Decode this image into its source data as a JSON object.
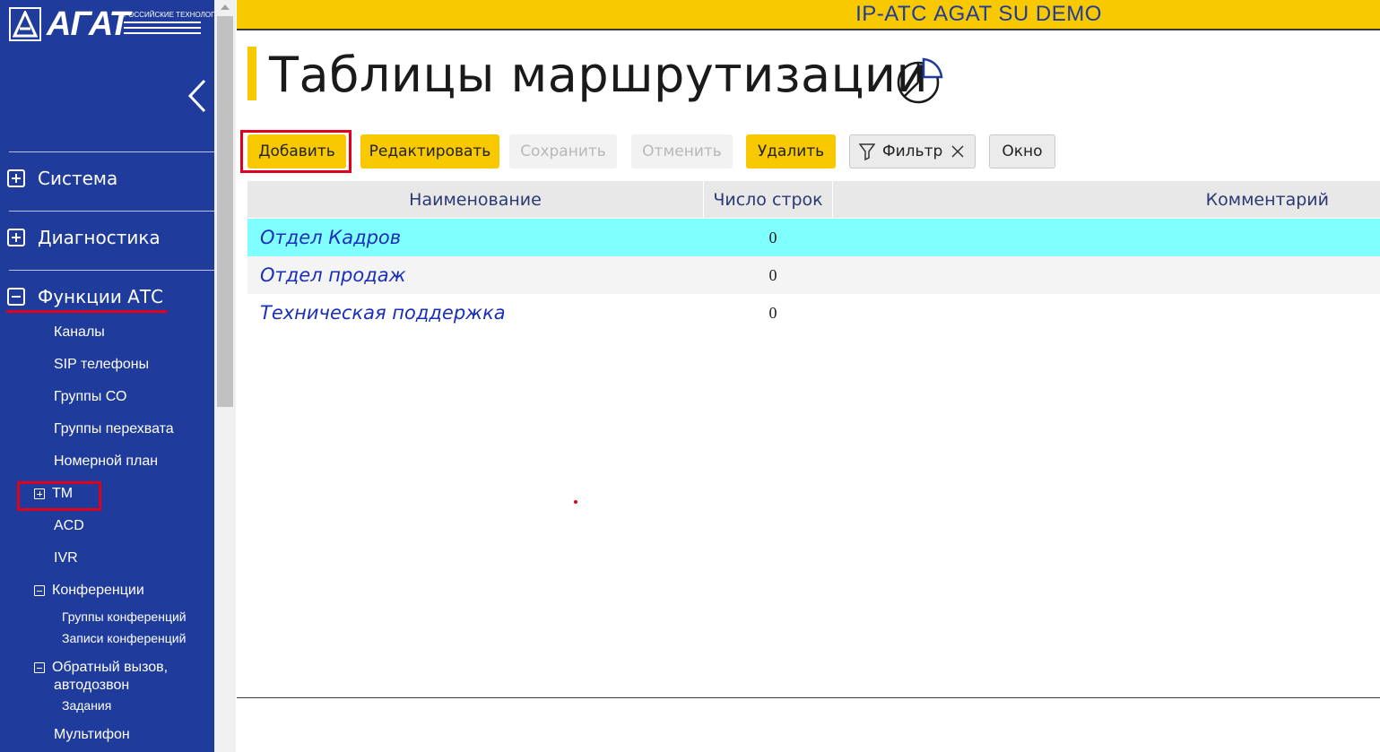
{
  "brand": {
    "logo_text": "АГАТ",
    "logo_subtitle": "РОССИЙСКИЕ ТЕХНОЛОГИИ"
  },
  "header": {
    "title": "IP-АТС AGAT SU DEMO"
  },
  "sidebar": {
    "sections": [
      {
        "label": "Система",
        "expanded": false
      },
      {
        "label": "Диагностика",
        "expanded": false
      },
      {
        "label": "Функции АТС",
        "expanded": true
      }
    ],
    "items": [
      {
        "label": "Каналы"
      },
      {
        "label": "SIP телефоны"
      },
      {
        "label": "Группы СО"
      },
      {
        "label": "Группы перехвата"
      },
      {
        "label": "Номерной план"
      },
      {
        "label": "ТМ"
      },
      {
        "label": "ACD"
      },
      {
        "label": "IVR"
      },
      {
        "label": "Конференции"
      },
      {
        "label": "Группы конференций"
      },
      {
        "label": "Записи конференций"
      },
      {
        "label": "Обратный вызов,"
      },
      {
        "label": "автодозвон"
      },
      {
        "label": "Задания"
      },
      {
        "label": "Мультифон"
      }
    ]
  },
  "page": {
    "title": "Таблицы маршрутизации"
  },
  "toolbar": {
    "add": "Добавить",
    "edit": "Редактировать",
    "save": "Сохранить",
    "cancel": "Отменить",
    "delete": "Удалить",
    "filter": "Фильтр",
    "window": "Окно"
  },
  "table": {
    "columns": [
      "Наименование",
      "Число строк",
      "Комментарий"
    ],
    "rows": [
      {
        "name": "Отдел Кадров",
        "count": "0",
        "comment": "",
        "selected": true
      },
      {
        "name": "Отдел продаж",
        "count": "0",
        "comment": "",
        "selected": false
      },
      {
        "name": "Техническая поддержка",
        "count": "0",
        "comment": "",
        "selected": false
      }
    ]
  },
  "colors": {
    "sidebar_bg": "#1f3b9b",
    "accent_yellow": "#f9c900",
    "selected_row": "#80ffff",
    "highlight_red": "#e0001b",
    "link_blue": "#1a2fb8"
  }
}
